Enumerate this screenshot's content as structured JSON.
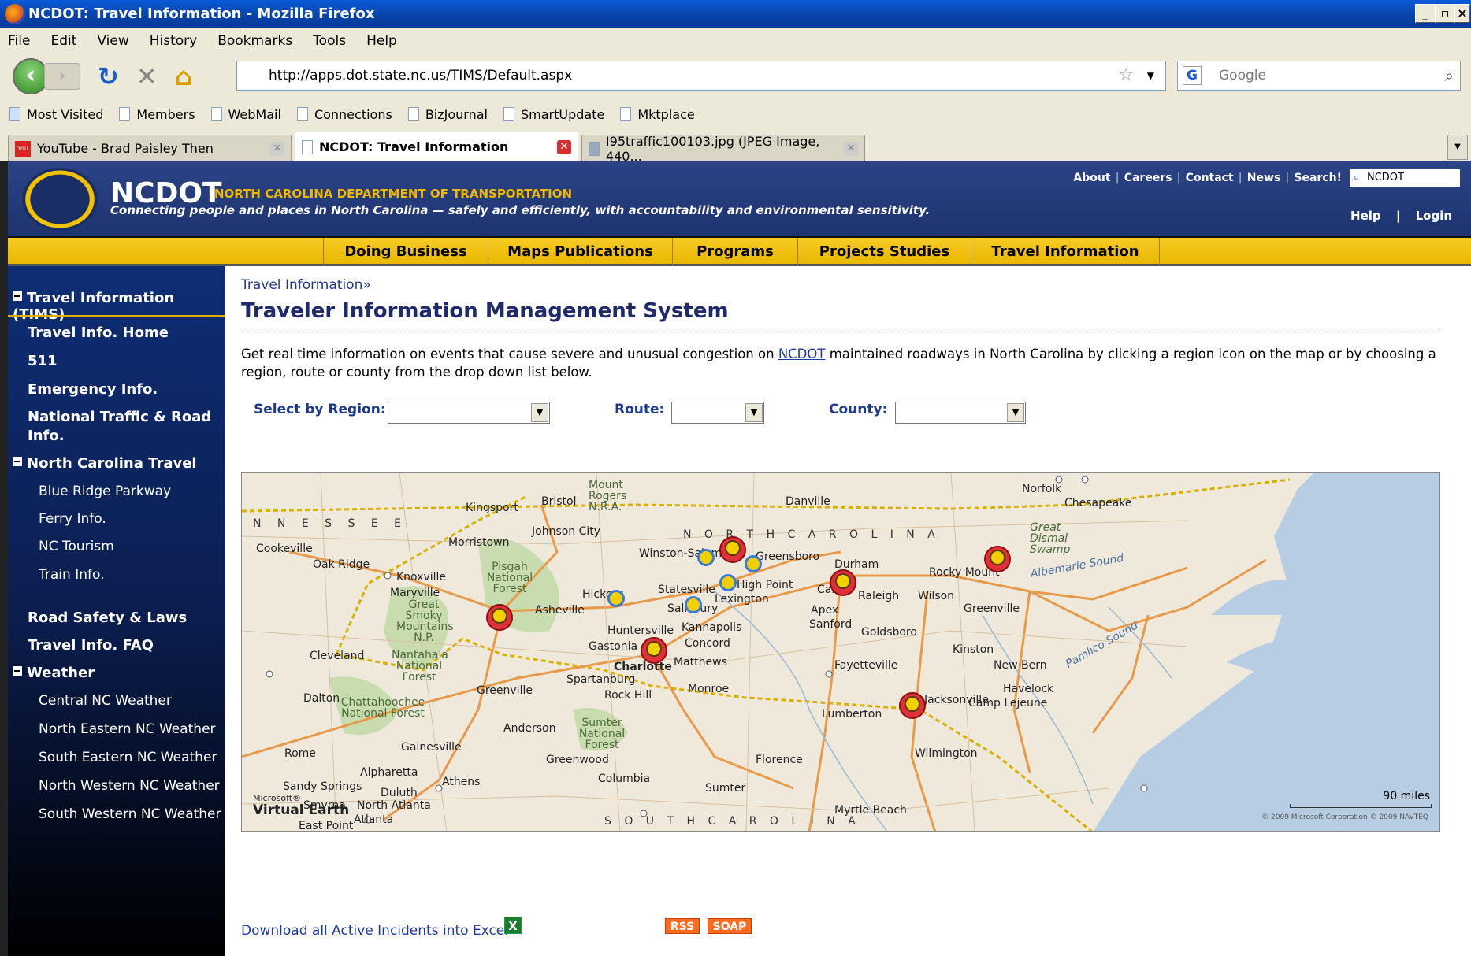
{
  "window": {
    "title": "NCDOT: Travel Information - Mozilla Firefox"
  },
  "menu": [
    "File",
    "Edit",
    "View",
    "History",
    "Bookmarks",
    "Tools",
    "Help"
  ],
  "nav": {
    "url": "http://apps.dot.state.nc.us/TIMS/Default.aspx",
    "search_placeholder": "Google"
  },
  "bookmarks": [
    "Most Visited",
    "Members",
    "WebMail",
    "Connections",
    "BizJournal",
    "SmartUpdate",
    "Mktplace"
  ],
  "tabs": [
    {
      "label": "YouTube - Brad Paisley Then"
    },
    {
      "label": "NCDOT: Travel Information"
    },
    {
      "label": "I95traffic100103.jpg (JPEG Image, 440..."
    }
  ],
  "header": {
    "brand": "NCDOT",
    "brand_sub": "NORTH CAROLINA DEPARTMENT OF TRANSPORTATION",
    "tagline": "Connecting people and places in North Carolina — safely and efficiently, with accountability and environmental sensitivity.",
    "links": [
      "About",
      "Careers",
      "Contact",
      "News",
      "Search!"
    ],
    "search_value": "NCDOT",
    "help": "Help",
    "login": "Login"
  },
  "topnav": [
    "Doing Business",
    "Maps Publications",
    "Programs",
    "Projects Studies",
    "Travel Information"
  ],
  "sidebar": {
    "section1": "Travel Information (TIMS)",
    "items1": [
      "Travel Info. Home",
      "511",
      "Emergency Info.",
      "National Traffic & Road Info."
    ],
    "section2": "North Carolina Travel",
    "items2": [
      "Blue Ridge Parkway",
      "Ferry Info.",
      "NC Tourism",
      "Train Info."
    ],
    "items3": [
      "Road Safety & Laws",
      "Travel Info. FAQ"
    ],
    "section3": "Weather",
    "items4": [
      "Central NC Weather",
      "North Eastern NC Weather",
      "South Eastern NC Weather",
      "North Western NC Weather",
      "South Western NC Weather"
    ]
  },
  "content": {
    "breadcrumb": "Travel Information»",
    "title": "Traveler Information Management System",
    "intro_before": "Get real time information on events that cause severe and unusual congestion on ",
    "intro_link": "NCDOT",
    "intro_after": " maintained roadways in North Carolina by clicking a region icon on the map or by choosing a region, route or county from the drop down list below.",
    "labels": {
      "region": "Select by Region:",
      "route": "Route:",
      "county": "County:"
    },
    "selected": {
      "region": "",
      "route": "",
      "county": ""
    },
    "download": "Download all Active Incidents into Excel",
    "rss": "RSS",
    "soap": "SOAP"
  },
  "map": {
    "scale": "90 miles",
    "copyright": "© 2009 Microsoft Corporation   © 2009 NAVTEQ",
    "brand": "Virtual Earth",
    "brand_prefix": "Microsoft®",
    "states": [
      "N N E S S E E",
      "N O R T H   C A R O L I N A",
      "S O U T H   C A R O L I N A"
    ],
    "cities": [
      "Bristol",
      "Kingsport",
      "Mount Rogers N.R.A.",
      "Johnson City",
      "Morristown",
      "Cookeville",
      "Oak Ridge",
      "Knoxville",
      "Maryville",
      "Great Smoky Mountains N.P.",
      "Pisgah National Forest",
      "Asheville",
      "Hickory",
      "Statesville",
      "Winston-Salem",
      "Greensboro",
      "High Point",
      "Lexington",
      "Salisbury",
      "Kannapolis",
      "Concord",
      "Huntersville",
      "Gastonia",
      "Charlotte",
      "Matthews",
      "Monroe",
      "Rock Hill",
      "Spartanburg",
      "Greenville",
      "Anderson",
      "Sumter National Forest",
      "Greenwood",
      "Columbia",
      "Florence",
      "Sumter",
      "Durham",
      "Raleigh",
      "Cary",
      "Apex",
      "Sanford",
      "Wilson",
      "Rocky Mount",
      "Greenville",
      "Goldsboro",
      "Kinston",
      "New Bern",
      "Fayetteville",
      "Jacksonville",
      "Camp Lejeune",
      "Havelock",
      "Lumberton",
      "Wilmington",
      "Myrtle Beach",
      "Norfolk",
      "Chesapeake",
      "Great Dismal Swamp",
      "Danville",
      "Cleveland",
      "Dalton",
      "Chattahoochee National Forest",
      "Gainesville",
      "Rome",
      "Alpharetta",
      "Athens",
      "Sandy Springs",
      "Duluth",
      "North Atlanta",
      "Smyrna",
      "East Point",
      "Atlanta",
      "Albemarle Sound",
      "Pamlico Sound",
      "Nantahala National Forest"
    ],
    "water_labels": [
      "Albemarle Sound",
      "Pamlico Sound"
    ]
  },
  "colors": {
    "header": "#22397a",
    "yellow": "#f2c200",
    "link": "#1e3aa0",
    "incident": "#e0303a"
  }
}
